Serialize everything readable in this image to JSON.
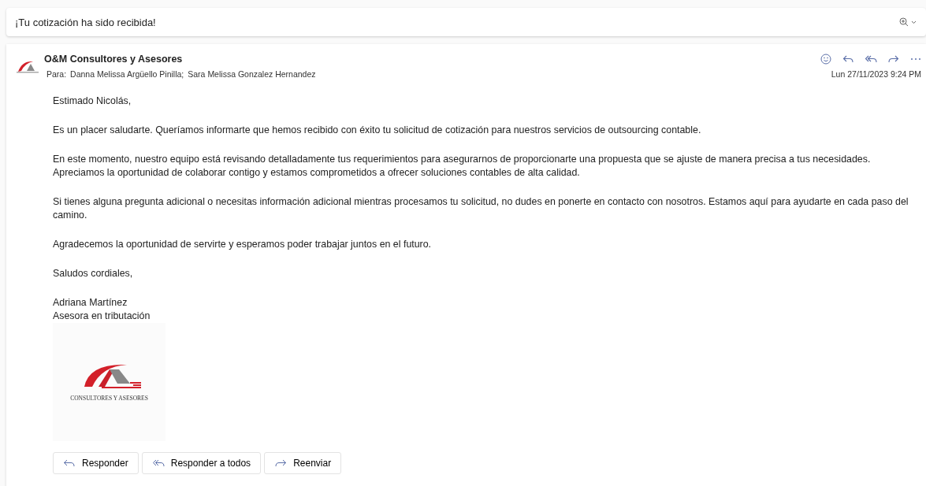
{
  "subject": "¡Tu cotización ha sido recibida!",
  "message": {
    "sender": "O&M Consultores y Asesores",
    "to_label": "Para:",
    "recipients": [
      "Danna Melissa Argüello Pinilla;",
      "Sara Melissa Gonzalez Hernandez"
    ],
    "date": "Lun 27/11/2023 9:24 PM",
    "body": [
      "Estimado Nicolás,",
      "Es un placer saludarte. Queríamos informarte que hemos recibido con éxito tu solicitud de cotización para nuestros servicios de outsourcing contable.",
      "En este momento, nuestro equipo está revisando detalladamente tus requerimientos para asegurarnos de proporcionarte una propuesta que se ajuste de manera precisa a tus necesidades. Apreciamos la oportunidad de colaborar contigo y estamos comprometidos a ofrecer soluciones contables de alta calidad.",
      "Si tienes alguna pregunta adicional o necesitas información adicional mientras procesamos tu solicitud, no dudes en ponerte en contacto con nosotros. Estamos aquí para ayudarte en cada paso del camino.",
      "Agradecemos la oportunidad de servirte y esperamos poder trabajar juntos en el futuro.",
      "Saludos cordiales,"
    ],
    "signature": [
      "Adriana Martínez",
      "Asesora en tributación"
    ],
    "logo_text": "CONSULTORES Y ASESORES"
  },
  "actions": [
    {
      "label": "Responder",
      "kind": "reply"
    },
    {
      "label": "Responder a todos",
      "kind": "reply-all"
    },
    {
      "label": "Reenviar",
      "kind": "forward"
    }
  ]
}
